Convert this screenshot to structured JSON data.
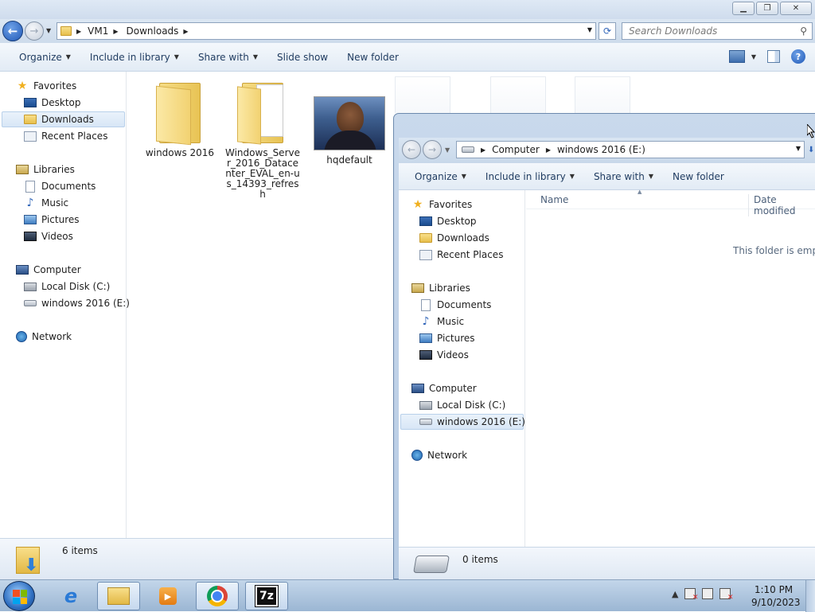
{
  "window1": {
    "address": [
      "VM1",
      "Downloads"
    ],
    "search_placeholder": "Search Downloads",
    "toolbar": [
      {
        "label": "Organize",
        "dropdown": true
      },
      {
        "label": "Include in library",
        "dropdown": true
      },
      {
        "label": "Share with",
        "dropdown": true
      },
      {
        "label": "Slide show",
        "dropdown": false
      },
      {
        "label": "New folder",
        "dropdown": false
      }
    ],
    "nav": {
      "favorites": "Favorites",
      "desktop": "Desktop",
      "downloads": "Downloads",
      "recent": "Recent Places",
      "libraries": "Libraries",
      "documents": "Documents",
      "music": "Music",
      "pictures": "Pictures",
      "videos": "Videos",
      "computer": "Computer",
      "local_disk": "Local Disk (C:)",
      "e_drive": "windows 2016 (E:)",
      "network": "Network"
    },
    "files": [
      {
        "name": "windows 2016",
        "icon": "folder-icon"
      },
      {
        "name": "Windows_Server_2016_Datacenter_EVAL_en-us_14393_refresh",
        "icon": "folder-with-documents-icon"
      },
      {
        "name": "hqdefault",
        "icon": "image-thumbnail"
      }
    ],
    "status_count": "6 items"
  },
  "window2": {
    "address": [
      "Computer",
      "windows 2016 (E:)"
    ],
    "toolbar": [
      {
        "label": "Organize",
        "dropdown": true
      },
      {
        "label": "Include in library",
        "dropdown": true
      },
      {
        "label": "Share with",
        "dropdown": true
      },
      {
        "label": "New folder",
        "dropdown": false
      }
    ],
    "nav": {
      "favorites": "Favorites",
      "desktop": "Desktop",
      "downloads": "Downloads",
      "recent": "Recent Places",
      "libraries": "Libraries",
      "documents": "Documents",
      "music": "Music",
      "pictures": "Pictures",
      "videos": "Videos",
      "computer": "Computer",
      "local_disk": "Local Disk (C:)",
      "e_drive": "windows 2016 (E:)",
      "network": "Network"
    },
    "columns": {
      "name": "Name",
      "date": "Date modified"
    },
    "empty_text": "This folder is empty.",
    "status_count": "0 items"
  },
  "taskbar": {
    "apps": [
      "internet-explorer",
      "windows-explorer",
      "windows-media-player",
      "google-chrome",
      "7-zip"
    ],
    "time": "1:10 PM",
    "date": "9/10/2023"
  }
}
